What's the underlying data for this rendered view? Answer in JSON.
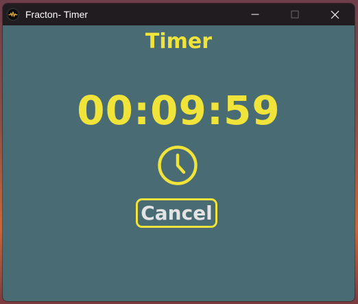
{
  "window": {
    "title": "Fracton- Timer"
  },
  "titlebar_controls": [
    "minimize-icon",
    "maximize-icon",
    "close-icon"
  ],
  "timer": {
    "heading": "Timer",
    "time": "00:09:59",
    "cancel_label": "Cancel"
  },
  "colors": {
    "accent": "#f0e33a",
    "background": "#496b73",
    "titlebar": "#201c20",
    "button_text": "#e3e3e3"
  },
  "icons": {
    "app": "app-logo-icon",
    "timer": "clock-icon"
  }
}
